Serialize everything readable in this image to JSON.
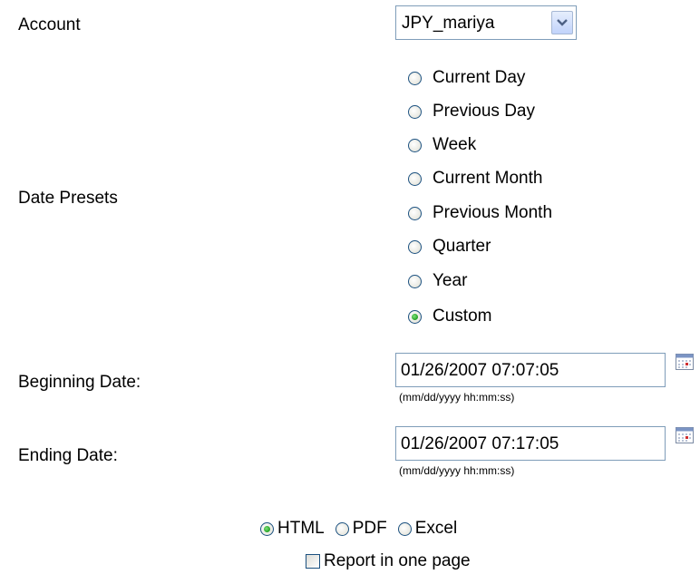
{
  "account": {
    "label": "Account",
    "selected": "JPY_mariya"
  },
  "date_presets": {
    "label": "Date Presets",
    "options": [
      {
        "label": "Current Day",
        "checked": false
      },
      {
        "label": "Previous Day",
        "checked": false
      },
      {
        "label": "Week",
        "checked": false
      },
      {
        "label": "Current Month",
        "checked": false
      },
      {
        "label": "Previous Month",
        "checked": false
      },
      {
        "label": "Quarter",
        "checked": false
      },
      {
        "label": "Year",
        "checked": false
      },
      {
        "label": "Custom",
        "checked": true
      }
    ]
  },
  "beginning_date": {
    "label": "Beginning Date:",
    "value": "01/26/2007 07:07:05",
    "hint": "(mm/dd/yyyy hh:mm:ss)"
  },
  "ending_date": {
    "label": "Ending Date:",
    "value": "01/26/2007 07:17:05",
    "hint": "(mm/dd/yyyy hh:mm:ss)"
  },
  "format": {
    "options": [
      {
        "label": "HTML",
        "checked": true
      },
      {
        "label": "PDF",
        "checked": false
      },
      {
        "label": "Excel",
        "checked": false
      }
    ]
  },
  "one_page": {
    "label": "Report in one page",
    "checked": false
  },
  "colors": {
    "radio_border": "#1c5180",
    "radio_checked": "#21a121",
    "input_border": "#7f9db9"
  },
  "icons": {
    "dropdown": "chevron-down-icon",
    "calendar": "calendar-icon"
  }
}
